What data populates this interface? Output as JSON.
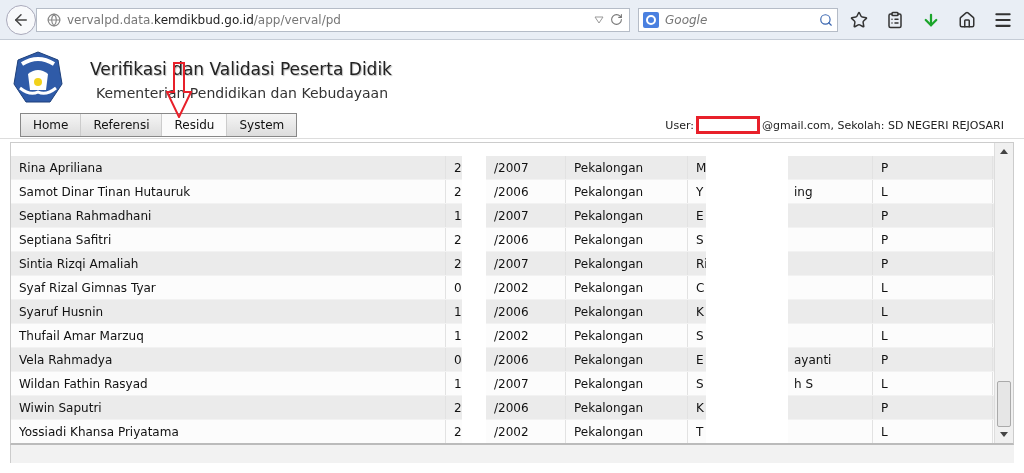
{
  "browser": {
    "url": "vervalpd.data.**kemdikbud.go.id**/app/verval/pd",
    "search": {
      "placeholder": "Google"
    }
  },
  "header": {
    "title": "Verifikasi dan Validasi Peserta Didik",
    "subtitle": "Kementerian Pendidikan dan Kebudayaan"
  },
  "nav": [
    {
      "label": "Home",
      "selected": false
    },
    {
      "label": "Referensi",
      "selected": false
    },
    {
      "label": "Residu",
      "selected": true
    },
    {
      "label": "System",
      "selected": false
    }
  ],
  "user": {
    "label": "User:",
    "info": "@gmail.com, Sekolah: SD NEGERI REJOSARI"
  },
  "table": {
    "rows": [
      {
        "name": "Rina Apriliana",
        "column_2": "2",
        "column_3": "/2007",
        "column_4": "Pekalongan",
        "column_5": "M",
        "column_7": "P"
      },
      {
        "name": "Samot Dinar Tinan Hutauruk",
        "column_2": "2",
        "column_3": "/2006",
        "column_4": "Pekalongan",
        "column_5": "Y",
        "column_6": "ing",
        "column_7": "L"
      },
      {
        "name": "Septiana Rahmadhani",
        "column_2": "1",
        "column_3": "/2007",
        "column_4": "Pekalongan",
        "column_5": "E",
        "column_7": "P"
      },
      {
        "name": "Septiana Safitri",
        "column_2": "2",
        "column_3": "/2006",
        "column_4": "Pekalongan",
        "column_5": "S",
        "column_7": "P"
      },
      {
        "name": "Sintia Rizqi Amaliah",
        "column_2": "2",
        "column_3": "/2007",
        "column_4": "Pekalongan",
        "column_5": "Ri",
        "column_7": "P"
      },
      {
        "name": "Syaf Rizal Gimnas Tyar",
        "column_2": "0",
        "column_3": "/2002",
        "column_4": "Pekalongan",
        "column_5": "C",
        "column_7": "L"
      },
      {
        "name": "Syaruf Husnin",
        "column_2": "1",
        "column_3": "/2006",
        "column_4": "Pekalongan",
        "column_5": "K",
        "column_7": "L"
      },
      {
        "name": "Thufail Amar Marzuq",
        "column_2": "1",
        "column_3": "/2002",
        "column_4": "Pekalongan",
        "column_5": "S",
        "column_7": "L"
      },
      {
        "name": "Vela Rahmadya",
        "column_2": "0",
        "column_3": "/2006",
        "column_4": "Pekalongan",
        "column_5": "E",
        "column_6": "ayanti",
        "column_7": "P"
      },
      {
        "name": "Wildan Fathin Rasyad",
        "column_2": "1",
        "column_3": "/2007",
        "column_4": "Pekalongan",
        "column_5": "S",
        "column_6": "h S",
        "column_7": "L"
      },
      {
        "name": "Wiwin Saputri",
        "column_2": "2",
        "column_3": "/2006",
        "column_4": "Pekalongan",
        "column_5": "K",
        "column_7": "P"
      },
      {
        "name": "Yossiadi Khansa Priyatama",
        "column_2": "2",
        "column_3": "/2002",
        "column_4": "Pekalongan",
        "column_5": "T",
        "column_7": "L"
      }
    ]
  }
}
